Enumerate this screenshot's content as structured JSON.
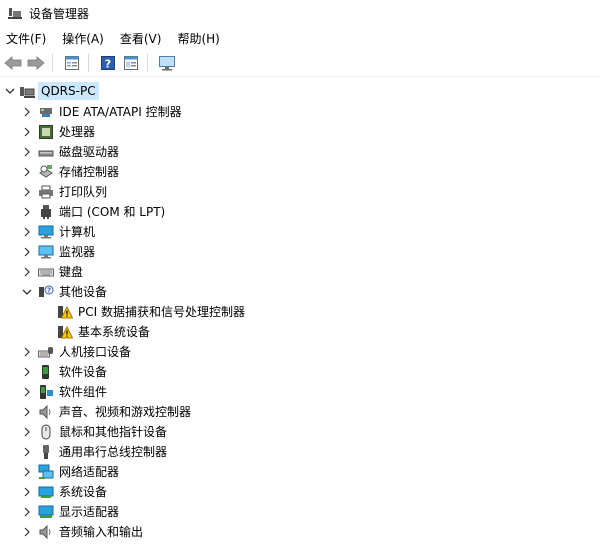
{
  "window": {
    "title": "设备管理器"
  },
  "menu": [
    "文件(F)",
    "操作(A)",
    "查看(V)",
    "帮助(H)"
  ],
  "toolbar_icons": [
    "back-arrow-icon",
    "forward-arrow-icon",
    "properties-icon",
    "help-icon",
    "view-icon",
    "monitor-scan-icon"
  ],
  "tree": {
    "root": "QDRS-PC",
    "categories": [
      {
        "label": "IDE ATA/ATAPI 控制器",
        "icon": "ide-controller-icon",
        "expanded": false
      },
      {
        "label": "处理器",
        "icon": "processor-icon",
        "expanded": false
      },
      {
        "label": "磁盘驱动器",
        "icon": "disk-drive-icon",
        "expanded": false
      },
      {
        "label": "存储控制器",
        "icon": "storage-controller-icon",
        "expanded": false
      },
      {
        "label": "打印队列",
        "icon": "printer-icon",
        "expanded": false
      },
      {
        "label": "端口 (COM 和 LPT)",
        "icon": "port-icon",
        "expanded": false
      },
      {
        "label": "计算机",
        "icon": "computer-icon",
        "expanded": false
      },
      {
        "label": "监视器",
        "icon": "monitor-icon",
        "expanded": false
      },
      {
        "label": "键盘",
        "icon": "keyboard-icon",
        "expanded": false
      },
      {
        "label": "其他设备",
        "icon": "unknown-device-icon",
        "expanded": true,
        "children": [
          {
            "label": "PCI 数据捕获和信号处理控制器",
            "icon": "warning-device-icon"
          },
          {
            "label": "基本系统设备",
            "icon": "warning-device-icon"
          }
        ]
      },
      {
        "label": "人机接口设备",
        "icon": "hid-icon",
        "expanded": false
      },
      {
        "label": "软件设备",
        "icon": "software-device-icon",
        "expanded": false
      },
      {
        "label": "软件组件",
        "icon": "software-component-icon",
        "expanded": false
      },
      {
        "label": "声音、视频和游戏控制器",
        "icon": "speaker-icon",
        "expanded": false
      },
      {
        "label": "鼠标和其他指针设备",
        "icon": "mouse-icon",
        "expanded": false
      },
      {
        "label": "通用串行总线控制器",
        "icon": "usb-icon",
        "expanded": false
      },
      {
        "label": "网络适配器",
        "icon": "network-adapter-icon",
        "expanded": false
      },
      {
        "label": "系统设备",
        "icon": "system-device-icon",
        "expanded": false
      },
      {
        "label": "显示适配器",
        "icon": "display-adapter-icon",
        "expanded": false
      },
      {
        "label": "音频输入和输出",
        "icon": "audio-io-icon",
        "expanded": false
      }
    ]
  }
}
